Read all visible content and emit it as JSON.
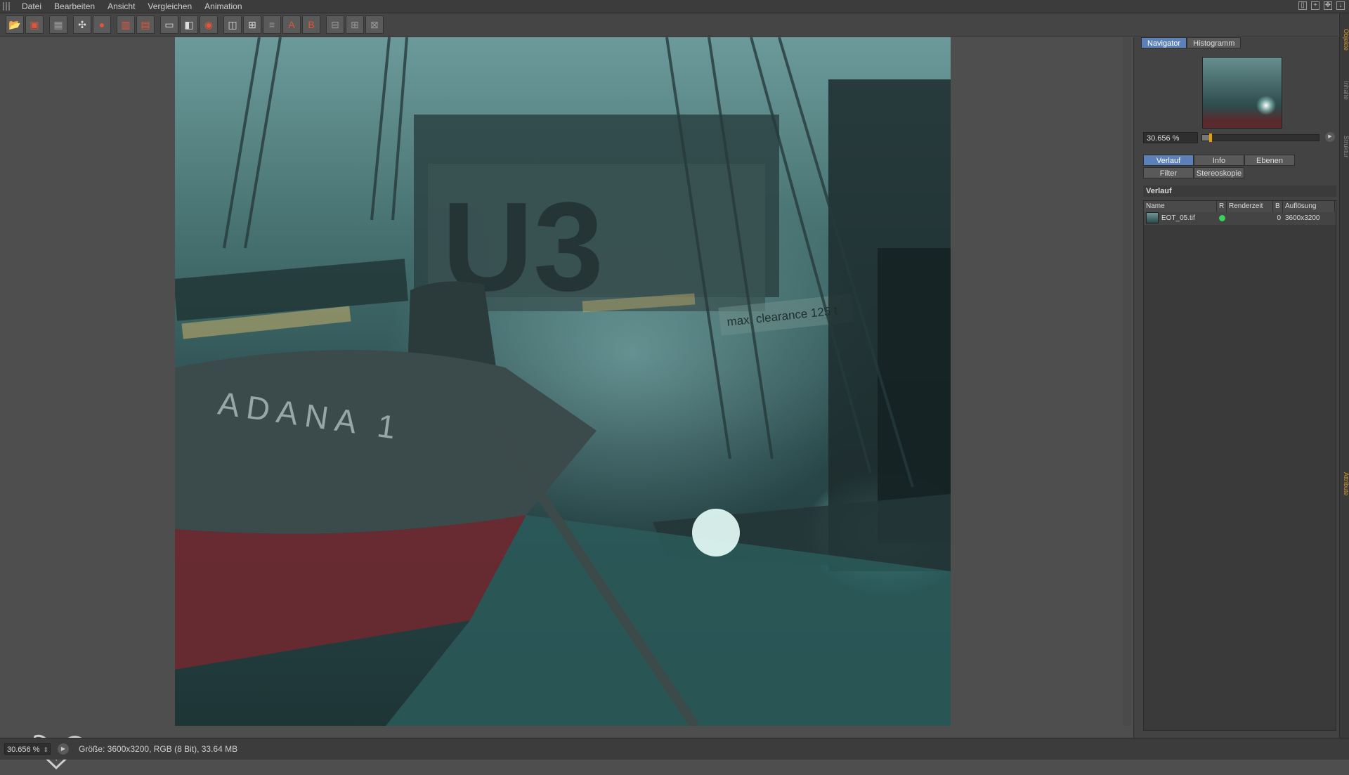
{
  "menu": {
    "items": [
      "Datei",
      "Bearbeiten",
      "Ansicht",
      "Vergleichen",
      "Animation"
    ]
  },
  "toolbar": {
    "groups": [
      [
        "open-icon",
        "save-icon"
      ],
      [
        "grid-icon"
      ],
      [
        "move-icon",
        "person-icon"
      ],
      [
        "render-region-icon",
        "render-stack-icon"
      ],
      [
        "display-icon",
        "display-split-icon",
        "display-settings-icon"
      ],
      [
        "ab-compare-icon",
        "grid-select-icon",
        "text-compare-icon",
        "a-icon",
        "b-icon"
      ],
      [
        "layout-1-icon",
        "layout-2-icon",
        "layout-3-icon"
      ]
    ]
  },
  "image": {
    "hull_text": "ADANA 1",
    "dock_sign": "U3",
    "clearance_sign": "max. clearance 125 t",
    "accent_colors": {
      "hull_red": "#6a2a30",
      "water": "#2b5a5a",
      "light": "#e8fffb"
    }
  },
  "status": {
    "zoom": "30.656 %",
    "info": "Größe: 3600x3200, RGB (8 Bit), 33.64 MB"
  },
  "panel": {
    "nav_tabs": [
      "Navigator",
      "Histogramm"
    ],
    "nav_active": "Navigator",
    "nav_zoom": "30.656 %",
    "nav_zoom_fraction": 0.07,
    "tabs_row1": [
      "Verlauf",
      "Info",
      "Ebenen"
    ],
    "tabs_row2": [
      "Filter",
      "Stereoskopie"
    ],
    "active_tab": "Verlauf",
    "section_title": "Verlauf",
    "columns": [
      "Name",
      "R",
      "Renderzeit",
      "B",
      "Auflösung"
    ],
    "rows": [
      {
        "name": "EOT_05.tif",
        "r": "",
        "render_time": "",
        "b": "0",
        "resolution": "3600x3200"
      }
    ]
  },
  "side_strip": [
    "Objekte",
    "Attribute",
    "Inhalte",
    "Struktur"
  ]
}
